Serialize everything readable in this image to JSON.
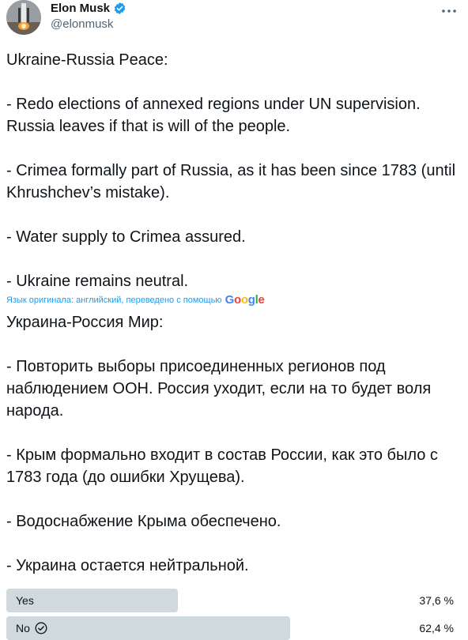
{
  "author": {
    "name": "Elon Musk",
    "handle": "@elonmusk",
    "avatar_icon": "avatar-rocket-image",
    "verified_icon": "verified-badge-icon",
    "verified_color": "#1d9bf0"
  },
  "tweet": {
    "text_en": "Ukraine-Russia Peace:\n\n- Redo elections of annexed regions under UN supervision. Russia leaves if that is will of the people.\n\n- Crimea formally part of Russia, as it has been since 1783 (until Khrushchev’s mistake).\n\n- Water supply to Crimea assured.\n\n- Ukraine remains neutral.",
    "translation_note": "Язык оригинала: английский, переведено с помощью",
    "translation_provider": "Google",
    "text_ru": "Украина-Россия Мир:\n\n- Повторить выборы присоединенных регионов под наблюдением ООН. Россия уходит, если на то будет воля народа.\n\n- Крым формально входит в состав России, как это было с 1783 года (до ошибки Хрущева).\n\n- Водоснабжение Крыма обеспечено.\n\n- Украина остается нейтральной."
  },
  "poll": {
    "options": [
      {
        "label": "Yes",
        "percent_text": "37,6 %",
        "share": 0.376,
        "selected": false
      },
      {
        "label": "No",
        "percent_text": "62,4 %",
        "share": 0.624,
        "selected": true
      }
    ],
    "bar_color": "#cfd9de"
  },
  "icons": {
    "more": "more-options-icon",
    "check": "check-circle-icon"
  },
  "colors": {
    "link": "#1d9bf0",
    "text": "#0f1419",
    "secondary": "#536471"
  }
}
